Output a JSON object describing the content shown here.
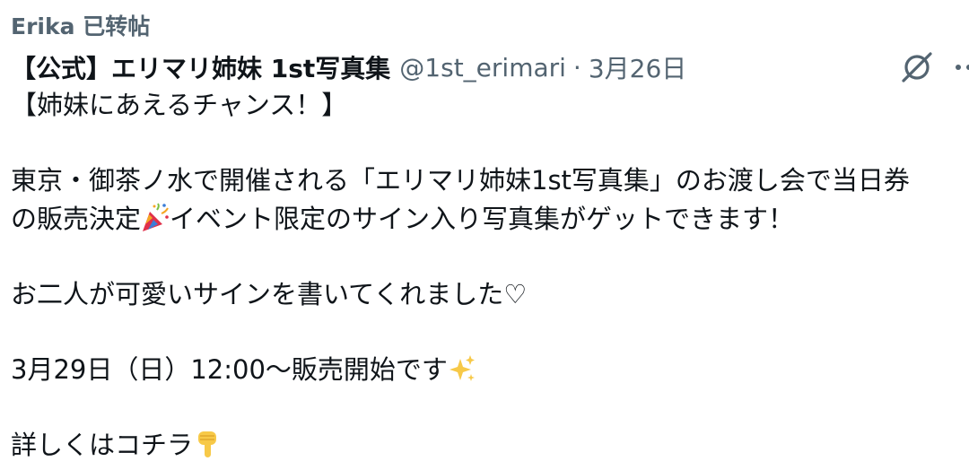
{
  "retweet": {
    "user": "Erika",
    "action": "已转帖"
  },
  "tweet": {
    "display_name": "【公式】エリマリ姉妹 1st写真集",
    "handle": "@1st_erimari",
    "separator": "·",
    "date": "3月26日",
    "lines": [
      "【姉妹にあえるチャンス！】",
      "東京・御茶ノ水で開催される「エリマリ姉妹1st写真集」のお渡し会で当日券",
      "の販売決定",
      "イベント限定のサイン入り写真集がゲットできます！",
      "お二人が可愛いサインを書いてくれました♡",
      "3月29日（日）12:00〜販売開始です",
      "詳しくはコチラ"
    ]
  },
  "icons": {
    "grok": "grok-icon",
    "more": "more-dots-icon",
    "party": "party-popper-icon",
    "sparkles": "sparkles-icon",
    "point_down": "backhand-index-pointing-down-icon"
  },
  "colors": {
    "text": "#0f1419",
    "secondary": "#536471",
    "background": "#ffffff"
  }
}
